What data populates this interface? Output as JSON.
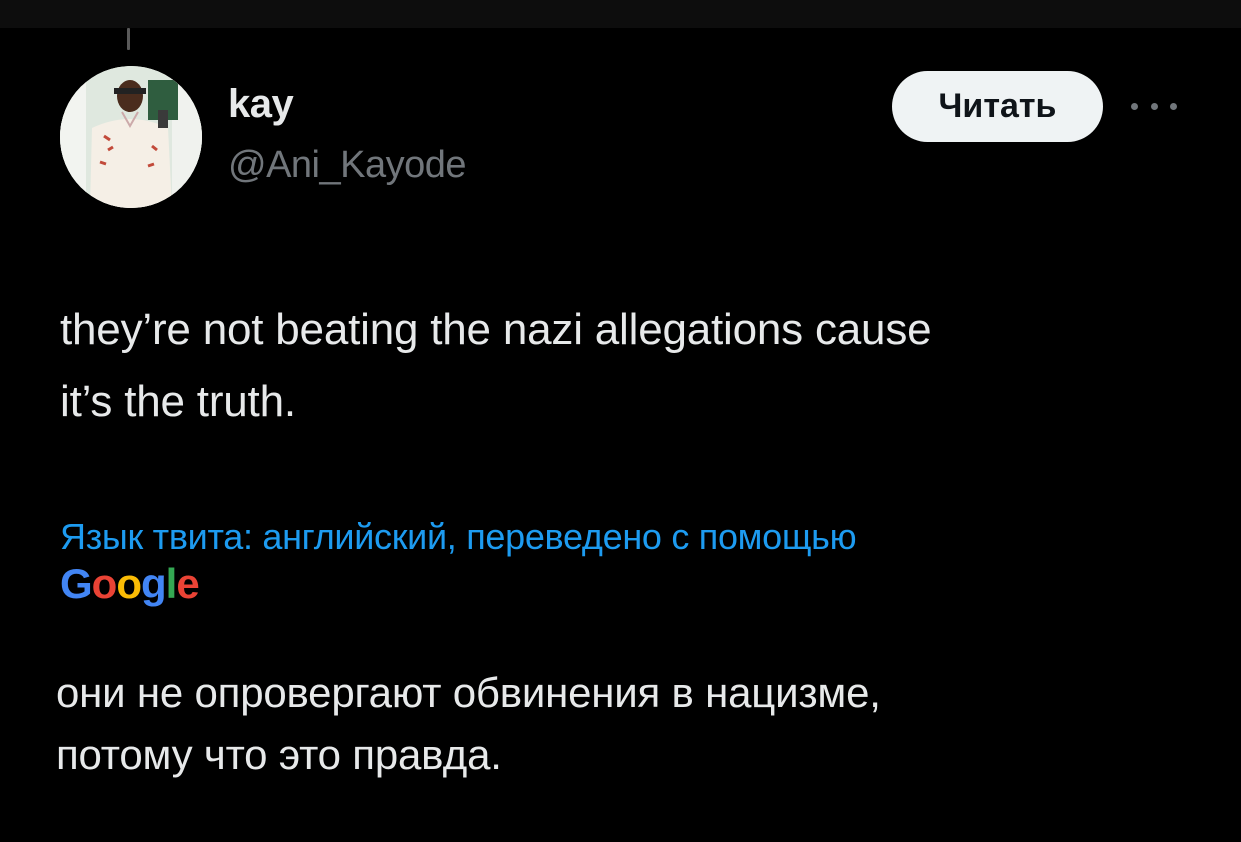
{
  "tweet": {
    "display_name": "kay",
    "handle": "@Ani_Kayode",
    "follow_label": "Читать",
    "text_line1": "they’re not beating the nazi allegations cause",
    "text_line2": "it’s the truth.",
    "translate_note": "Язык твита: английский, переведено с помощью",
    "translator_logo": "Google",
    "translated_line1": "они не опровергают обвинения в нацизме,",
    "translated_line2": "потому что это правда."
  },
  "icons": {
    "more": "more-horizontal-icon",
    "avatar": "profile-photo"
  },
  "colors": {
    "background": "#000000",
    "text": "#e7e9ea",
    "secondary": "#71767b",
    "link": "#1d9bf0",
    "button_bg": "#eff3f4"
  }
}
